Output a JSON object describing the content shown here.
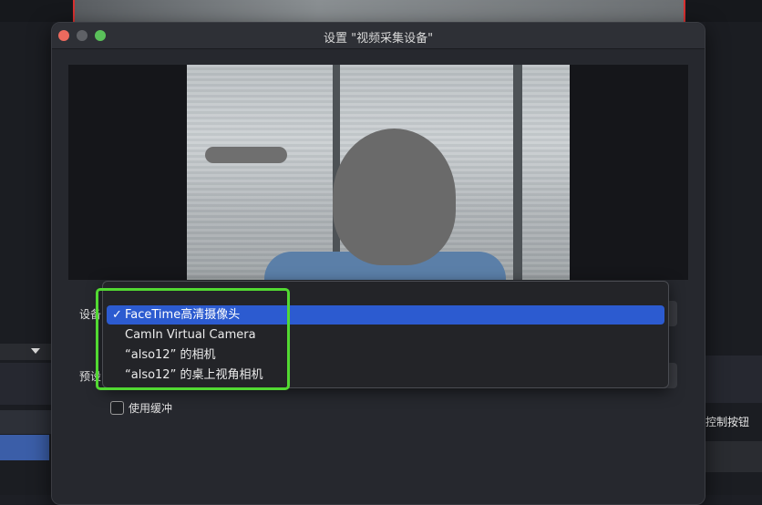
{
  "window": {
    "title": "设置 \"视频采集设备\""
  },
  "form": {
    "device_label": "设备",
    "preset_label": "预设",
    "buffer_label": "使用缓冲",
    "buffer_checked": false
  },
  "device_menu": {
    "check_mark": "✓",
    "items": [
      {
        "label": "FaceTime高清摄像头",
        "selected": true
      },
      {
        "label": "CamIn Virtual Camera",
        "selected": false
      },
      {
        "label": "“also12” 的相机",
        "selected": false
      },
      {
        "label": "“also12” 的桌上视角相机",
        "selected": false
      }
    ]
  },
  "background_app": {
    "right_label": "控制按钮",
    "right_label_prefix": "|"
  },
  "colors": {
    "menu_selected": "#2c5bd0",
    "highlight": "#52d932",
    "close_button": "#ed6a5e",
    "maximize_button": "#5ac05a"
  },
  "icons": {
    "close": "close-icon",
    "minimize": "minimize-icon",
    "maximize": "maximize-icon",
    "check": "checkmark-icon"
  }
}
